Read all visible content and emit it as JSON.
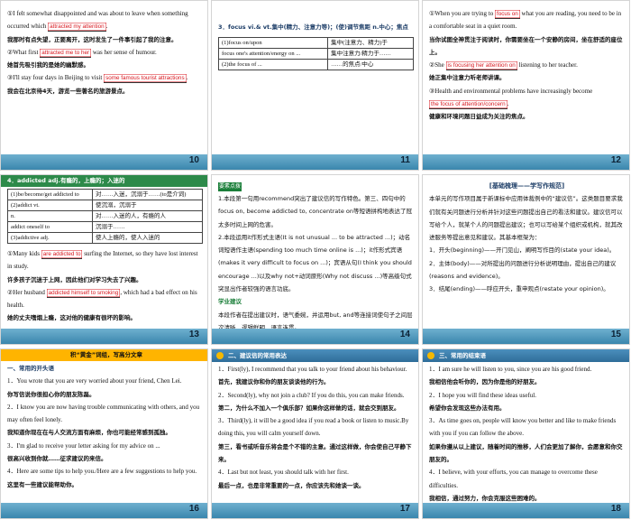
{
  "slides": [
    {
      "page": "10",
      "lines": [
        {
          "pre": "①I felt somewhat disappointed and was about to leave when something occurred which ",
          "fill": "attracted my attention",
          "post": "."
        },
        {
          "cn": "我那时有点失望，正要离开，这时发生了一件事引起了我的注意。"
        },
        {
          "pre": "②What first ",
          "fill": "attracted me to her",
          "post": " was her sense of humour."
        },
        {
          "cn": "她首先吸引我的是她的幽默感。"
        },
        {
          "pre": "③I'll stay four days in Beijing to visit ",
          "fill": "some famous tourist attractions",
          "post": "."
        },
        {
          "cn": "我会在北京待4天，游览一些著名的旅游景点。"
        }
      ]
    },
    {
      "page": "11",
      "head": "3．focus vi.& vt.集中(精力、注意力等)；(使)调节焦距 n.中心；焦点",
      "rows": [
        [
          "(1)focus on/upon",
          "集中(注意力、精力)于"
        ],
        [
          "focus one's attention/energy on ...",
          "集中注意力/精力于……"
        ],
        [
          "(2)the focus of ...",
          "……的焦点/中心"
        ]
      ]
    },
    {
      "page": "12",
      "lines": [
        {
          "pre": "①When you are trying to ",
          "fill": "focus on",
          "post": " what you are reading, you need to be in a comfortable seat in a quiet room."
        },
        {
          "cn": "当你试图全神贯注于阅读时，你需要坐在一个安静的房间，坐在舒适的座位上。"
        },
        {
          "pre": "②She ",
          "fill": "is focusing her attention on",
          "post": " listening to her teacher."
        },
        {
          "cn": "她正集中注意力听老师讲课。"
        },
        {
          "pre": "③Health and environmental problems have increasingly become ",
          "fill": "the focus of attention/concern",
          "post": "."
        },
        {
          "cn": "健康和环境问题日益成为关注的焦点。"
        }
      ]
    },
    {
      "page": "13",
      "head": "4．addicted adj.有瘾的，上瘾的；入迷的",
      "rows": [
        [
          "(1)be/become/get addicted to",
          "对……入迷，沉溺于……(to是介词)"
        ],
        [
          "(2)addict vt.",
          "使沉溺，沉溺于"
        ],
        [
          "n.",
          "对……入迷的人，有瘾的人"
        ],
        [
          "addict oneself to",
          "沉溺于……"
        ],
        [
          "(3)addictive adj.",
          "使人上瘾的，使人入迷的"
        ]
      ],
      "lines": [
        {
          "pre": "①Many kids ",
          "fill": "are addicted to",
          "post": " surfing the Internet, so they have lost interest in study."
        },
        {
          "cn": "许多孩子沉迷于上网，因此他们对学习失去了兴趣。"
        },
        {
          "pre": "②Her husband ",
          "fill": "addicted himself to smoking",
          "post": ", which had a bad effect on his health."
        },
        {
          "cn": "她的丈夫嗜烟上瘾，这对他的健康有很坏的影响。"
        }
      ]
    },
    {
      "page": "14",
      "tag": "要素点拨",
      "items": [
        "1.本段第一句用recommend突出了建议信的写作特色。第三、四句中的focus on, become addicted to, concentrate on等短语拼构地表达了冠太多时间上网的危害。",
        "2.本段运用it作形式主语(It is not unusual ... to be attracted ...)；动名词短语作主语(spending too much time online is ...)；it作形式宾语(makes it very difficult to focus on ...)；宾语从句(I think you should encourage ...)以及why not+动词原形(Why not discuss ...)等高级句式突显出作者较强的语言功底。",
        "学业建议",
        "本段作者在提出建议时，语气委婉，并运用but, and等连接词使句子之间层次清晰，逻辑鲜明，语言连贯。"
      ]
    },
    {
      "page": "15",
      "title": "[基础梳理——学写作规范]",
      "items": [
        "本单元的写作项目属于新课标中应用体裁例中的“建议信”。这类题目要求我们就有关问题进行分析并针对这些问题提出自己的看法和建议。建议信可以写给个人，就某个人的问题提出建议；也可以写给某个组织或机构，就其改进服务等提出意见和建议。其基本框架为：",
        "1．开头(beginning)——开门见山，阐明写作目的(state your idea)。",
        "2．主体(body)——对所提出的问题进行分析说明理由，提出自己的建议(reasons and evidence)。",
        "3．结尾(ending)——呼应开头，重申观点(restate your opinion)。"
      ]
    },
    {
      "page": "16",
      "section": "积“黄金”词组，写高分文章",
      "sub": "一、常用的开头语",
      "items": [
        "1．You wrote that you are very worried about your friend, Chen Lei.",
        "你写信说你很担心你的朋友陈磊。",
        "2．I know you are now having trouble communicating with others, and you may often feel lonely.",
        "我知道你现在在与人交流方面有麻烦，你也可能经常感到孤独。",
        "3．I'm glad to receive your letter asking for my advice on ...",
        "很高兴收到你就……征求建议的来信。",
        "4．Here are some tips to help you./Here are a few suggestions to help you.",
        "这里有一些建议能帮助你。"
      ]
    },
    {
      "page": "17",
      "tab": "二、建议信的常用表达",
      "items": [
        "1．First(ly), I recommend that you talk to your friend about his behaviour.",
        "首先，我建议你和你的朋友谈谈他的行为。",
        "2．Second(ly), why not join a club? If you do this, you can make friends.",
        "第二，为什么不加入一个俱乐部？如果你这样做的话，就会交到朋友。",
        "3．Third(ly), it will be a good idea if you read a book or listen to music.By doing this, you will calm yourself down.",
        "第三，看书或听音乐将会是个不错的主意。通过这样做，你会使自己平静下来。",
        "4．Last but not least, you should talk with her first.",
        "最后一点，也是非常重要的一点，你应该先和她谈一谈。"
      ]
    },
    {
      "page": "18",
      "tab": "三、常用的结束语",
      "items": [
        "1．I am sure he will listen to you, since you are his good friend.",
        "我相信他会听你的，因为你是他的好朋友。",
        "2．I hope you will find these ideas useful.",
        "希望你会发现这些办法有用。",
        "3．As time goes on, people will know you better and like to make friends with you if you can follow the above.",
        "如果你遵从以上建议，随着时间的推移，人们会更加了解你，会愿意和你交朋友的。",
        "4．I believe, with your efforts, you can manage to overcome these difficulties.",
        "我相信，通过努力，你会克服这些困难的。"
      ]
    }
  ]
}
